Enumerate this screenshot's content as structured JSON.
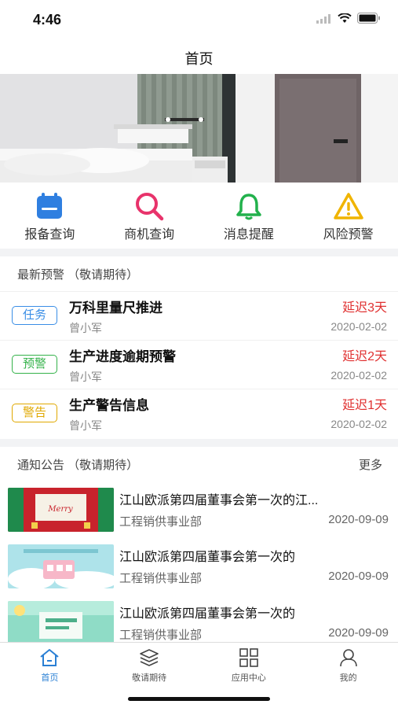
{
  "status": {
    "time": "4:46",
    "wifi_icon": "wifi-icon",
    "battery_icon": "battery-icon",
    "signal_icon": "signal-icon"
  },
  "nav": {
    "title": "首页"
  },
  "banner": {
    "image": "bedroom-interior-door"
  },
  "quick_menu": [
    {
      "label": "报备查询",
      "icon": "calendar-icon",
      "color": "#2f7fe0"
    },
    {
      "label": "商机查询",
      "icon": "search-icon",
      "color": "#e8336b"
    },
    {
      "label": "消息提醒",
      "icon": "bell-icon",
      "color": "#22b14c"
    },
    {
      "label": "风险预警",
      "icon": "warning-icon",
      "color": "#f0b400"
    }
  ],
  "alerts": {
    "title": "最新预警 （敬请期待）",
    "items": [
      {
        "tag": "任务",
        "tag_color": "#3a8ee6",
        "title": "万科里量尺推进",
        "person": "曾小军",
        "delay": "延迟3天",
        "date": "2020-02-02"
      },
      {
        "tag": "预警",
        "tag_color": "#34b24a",
        "title": "生产进度逾期预警",
        "person": "曾小军",
        "delay": "延迟2天",
        "date": "2020-02-02"
      },
      {
        "tag": "警告",
        "tag_color": "#e0a800",
        "title": "生产警告信息",
        "person": "曾小军",
        "delay": "延迟1天",
        "date": "2020-02-02"
      }
    ]
  },
  "notices": {
    "title": "通知公告 （敬请期待）",
    "more": "更多",
    "items": [
      {
        "title": "江山欧派第四届董事会第一次的江...",
        "dept": "工程销供事业部",
        "date": "2020-09-09",
        "thumb": "christmas-banner"
      },
      {
        "title": "江山欧派第四届董事会第一次的",
        "dept": "工程销供事业部",
        "date": "2020-09-09",
        "thumb": "childrens-day-banner"
      },
      {
        "title": "江山欧派第四届董事会第一次的",
        "dept": "工程销供事业部",
        "date": "2020-09-09",
        "thumb": "summer-banner"
      }
    ]
  },
  "tabs": [
    {
      "label": "首页",
      "icon": "home-icon",
      "active": true
    },
    {
      "label": "敬请期待",
      "icon": "layers-icon",
      "active": false
    },
    {
      "label": "应用中心",
      "icon": "grid-icon",
      "active": false
    },
    {
      "label": "我的",
      "icon": "user-icon",
      "active": false
    }
  ],
  "colors": {
    "accent": "#2a7fd4",
    "danger": "#e03030"
  }
}
